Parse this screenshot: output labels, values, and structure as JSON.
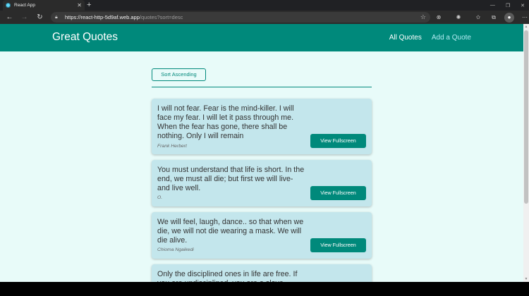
{
  "browser": {
    "tab_title": "React App",
    "tab_close": "✕",
    "new_tab": "+",
    "url_host": "https://react-http-5d9af.web.app",
    "url_path": "/quotes?sort=desc",
    "win_min": "—",
    "win_max": "❐",
    "win_close": "✕"
  },
  "header": {
    "brand": "Great Quotes",
    "nav": [
      "All Quotes",
      "Add a Quote"
    ]
  },
  "sort_button": "Sort Ascending",
  "fullscreen_label": "View Fullscreen",
  "quotes": [
    {
      "text": "I will not fear. Fear is the mind-killer. I will face my fear. I will let it pass through me. When the fear has gone, there shall be nothing. Only I will remain",
      "author": "Frank Herbert"
    },
    {
      "text": "You must understand that life is short. In the end, we must all die; but first we will live- and live well.",
      "author": "O."
    },
    {
      "text": "We will feel, laugh, dance.. so that when we die, we will not die wearing a mask. We will die alive.",
      "author": "Chioma Ngaikedi"
    },
    {
      "text": "Only the disciplined ones in life are free. If you are undisciplined, you are a slave",
      "author": ""
    }
  ],
  "colors": {
    "primary": "#00897b",
    "page_bg": "#e8fbf9",
    "card_bg": "#c3e6ec"
  }
}
